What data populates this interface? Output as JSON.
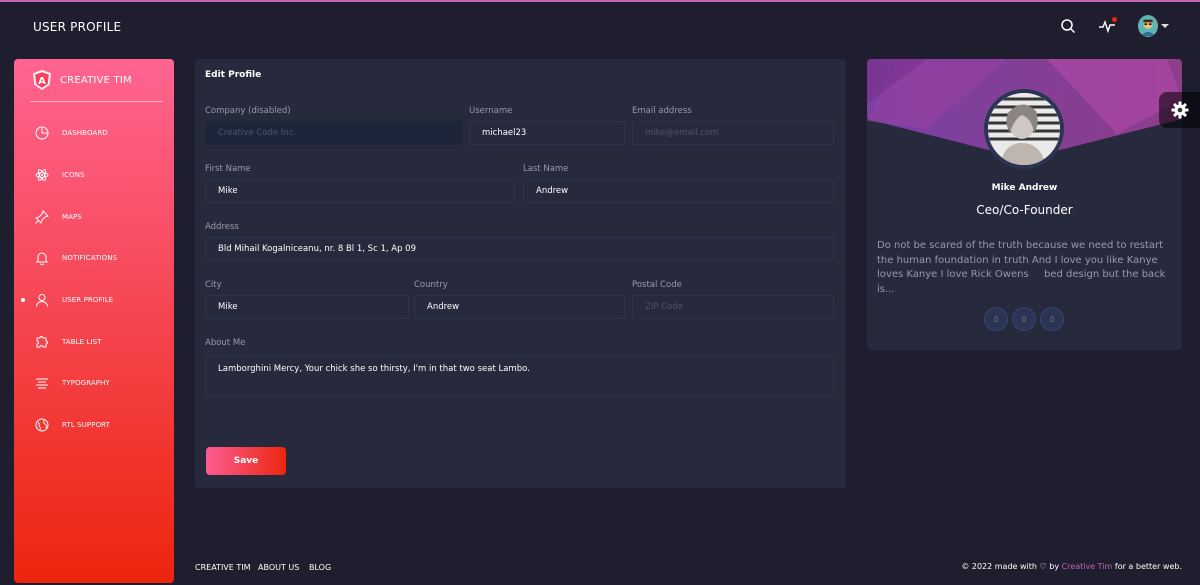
{
  "topbar": {
    "title": "USER PROFILE",
    "icons": [
      "search-icon",
      "activity-icon",
      "avatar"
    ]
  },
  "sidebar": {
    "brand": "CREATIVE TIM",
    "items": [
      {
        "label": "DASHBOARD",
        "icon": "chart-pie-icon"
      },
      {
        "label": "ICONS",
        "icon": "atom-icon"
      },
      {
        "label": "MAPS",
        "icon": "pin-icon"
      },
      {
        "label": "NOTIFICATIONS",
        "icon": "bell-icon"
      },
      {
        "label": "USER PROFILE",
        "icon": "user-icon",
        "active": true
      },
      {
        "label": "TABLE LIST",
        "icon": "puzzle-icon"
      },
      {
        "label": "TYPOGRAPHY",
        "icon": "align-icon"
      },
      {
        "label": "RTL SUPPORT",
        "icon": "world-icon"
      }
    ]
  },
  "edit_profile": {
    "title": "Edit Profile",
    "company": {
      "label": "Company (disabled)",
      "placeholder": "Creative Code Inc.",
      "value": ""
    },
    "username": {
      "label": "Username",
      "value": "michael23"
    },
    "email": {
      "label": "Email address",
      "placeholder": "mike@email.com",
      "value": ""
    },
    "first_name": {
      "label": "First Name",
      "value": "Mike"
    },
    "last_name": {
      "label": "Last Name",
      "value": "Andrew"
    },
    "address": {
      "label": "Address",
      "value": "Bld Mihail Kogalniceanu, nr. 8 Bl 1, Sc 1, Ap 09"
    },
    "city": {
      "label": "City",
      "value": "Mike"
    },
    "country": {
      "label": "Country",
      "value": "Andrew"
    },
    "postal": {
      "label": "Postal Code",
      "placeholder": "ZIP Code",
      "value": ""
    },
    "about": {
      "label": "About Me",
      "value": "Lamborghini Mercy, Your chick she so thirsty, I'm in that two seat Lambo."
    },
    "save_label": "Save"
  },
  "profile": {
    "name": "Mike Andrew",
    "role": "Ceo/Co-Founder",
    "bio": "Do not be scared of the truth because we need to restart the human foundation in truth And I love you like Kanye loves Kanye I love Rick Owens bed design but the back is...",
    "social": [
      "facebook-icon",
      "twitter-icon",
      "google-icon"
    ]
  },
  "footer": {
    "links": [
      "CREATIVE TIM",
      "ABOUT US",
      "BLOG"
    ],
    "copy_prefix": "© 2022 made with",
    "copy_by": "by",
    "copy_brand": "Creative Tim",
    "copy_suffix": "for a better web."
  },
  "colors": {
    "background": "#1e1e2f",
    "card": "#27293d",
    "sidebar_start": "#ff6491",
    "sidebar_end": "#ec250d",
    "accent": "#c264b8"
  }
}
